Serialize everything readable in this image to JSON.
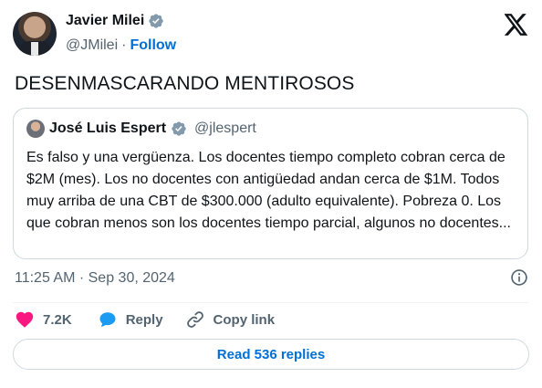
{
  "author": {
    "name": "Javier Milei",
    "handle": "@JMilei",
    "follow_label": "Follow"
  },
  "tweet": {
    "text": "DESENMASCARANDO MENTIROSOS",
    "timestamp": "11:25 AM · Sep 30, 2024"
  },
  "quoted": {
    "name": "José Luis Espert",
    "handle": "@jlespert",
    "text": "Es falso y una vergüenza. Los docentes tiempo completo cobran cerca de $2M (mes). Los no docentes con antigüedad andan cerca de $1M. Todos muy arriba de una CBT de $300.000 (adulto equivalente). Pobreza 0. Los que cobran menos son los docentes tiempo parcial, algunos no docentes..."
  },
  "actions": {
    "likes": "7.2K",
    "reply_label": "Reply",
    "copy_link_label": "Copy link"
  },
  "read_replies_label": "Read 536 replies",
  "colors": {
    "like": "#f91880",
    "reply": "#1d9bf0",
    "link": "#006fd6",
    "verified": "#829aab"
  }
}
